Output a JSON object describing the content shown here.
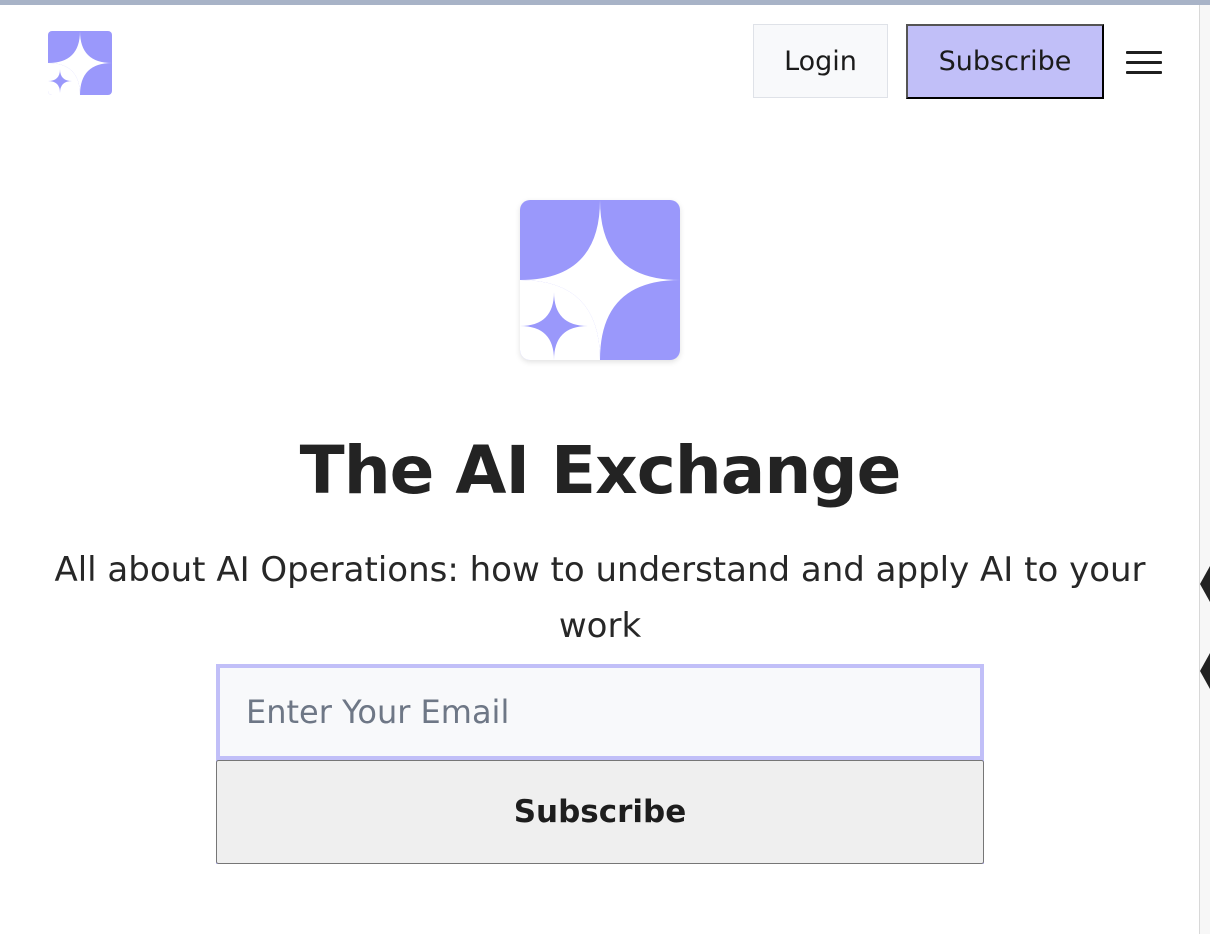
{
  "header": {
    "logo_icon": "sparkle-logo-icon",
    "login_label": "Login",
    "subscribe_label": "Subscribe",
    "menu_icon": "hamburger-menu-icon"
  },
  "hero": {
    "logo_icon": "sparkle-logo-icon",
    "title": "The AI Exchange",
    "subtitle": "All about AI Operations: how to understand and apply AI to your work"
  },
  "signup": {
    "email_placeholder": "Enter Your Email",
    "email_value": "",
    "subscribe_label": "Subscribe"
  },
  "colors": {
    "brand": "#9a98fb",
    "accent": "#c1bff8",
    "text": "#232323",
    "input_bg": "#f8f9fb"
  }
}
